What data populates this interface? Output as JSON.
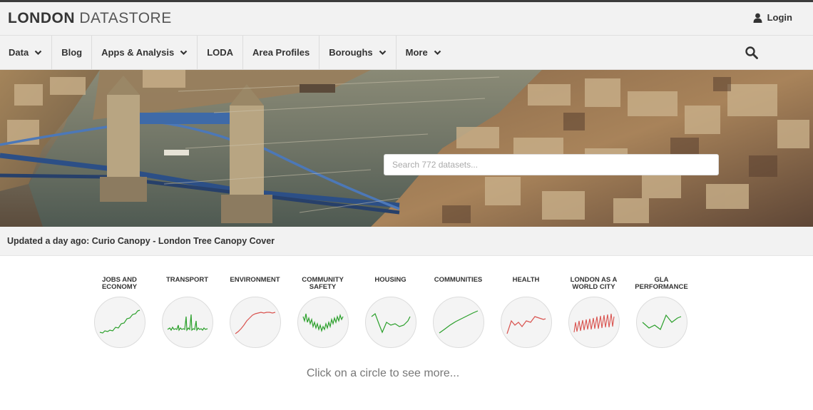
{
  "header": {
    "logo_bold": "LONDON",
    "logo_light": "DATASTORE",
    "login_label": "Login",
    "login_icon": "user-icon"
  },
  "nav": {
    "items": [
      {
        "label": "Data",
        "dropdown": true
      },
      {
        "label": "Blog",
        "dropdown": false
      },
      {
        "label": "Apps & Analysis",
        "dropdown": true
      },
      {
        "label": "LODA",
        "dropdown": false
      },
      {
        "label": "Area Profiles",
        "dropdown": false
      },
      {
        "label": "Boroughs",
        "dropdown": true
      },
      {
        "label": "More",
        "dropdown": true
      }
    ],
    "search_icon": "search-icon"
  },
  "hero": {
    "search_placeholder": "Search 772 datasets...",
    "image": "tower-bridge-aerial-photo"
  },
  "updated": {
    "prefix": "Updated a day ago:",
    "link_text": "Curio Canopy - London Tree Canopy Cover"
  },
  "topics": [
    {
      "line1": "JOBS AND",
      "line2": "ECONOMY",
      "color": "#2ca02c"
    },
    {
      "line1": "TRANSPORT",
      "line2": "",
      "color": "#2ca02c"
    },
    {
      "line1": "ENVIRONMENT",
      "line2": "",
      "color": "#d9534f"
    },
    {
      "line1": "COMMUNITY",
      "line2": "SAFETY",
      "color": "#2ca02c"
    },
    {
      "line1": "HOUSING",
      "line2": "",
      "color": "#2ca02c"
    },
    {
      "line1": "COMMUNITIES",
      "line2": "",
      "color": "#2ca02c"
    },
    {
      "line1": "HEALTH",
      "line2": "",
      "color": "#d9534f"
    },
    {
      "line1": "LONDON AS A",
      "line2": "WORLD CITY",
      "color": "#d9534f"
    },
    {
      "line1": "GLA",
      "line2": "PERFORMANCE",
      "color": "#2ca02c"
    }
  ],
  "hint": "Click on a circle to see more..."
}
